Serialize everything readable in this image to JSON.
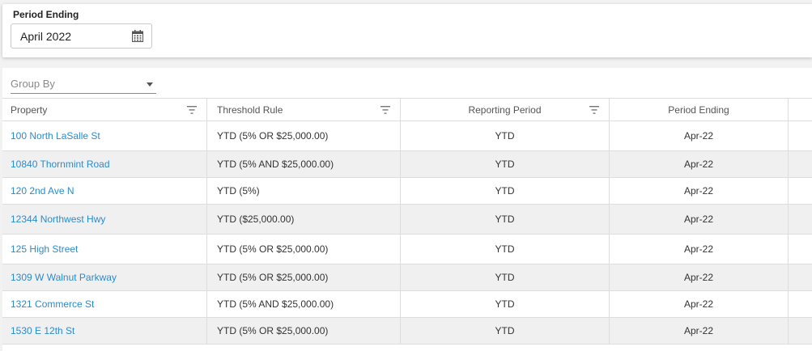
{
  "filters": {
    "period_label": "Period Ending",
    "period_value": "April 2022",
    "period_icon": "calendar-icon"
  },
  "group_by": {
    "placeholder": "Group By"
  },
  "table": {
    "columns": [
      "Property",
      "Threshold Rule",
      "Reporting Period",
      "Period Ending"
    ],
    "rows": [
      {
        "property": "100 North LaSalle St",
        "threshold": "YTD (5% OR $25,000.00)",
        "reporting": "YTD",
        "period": "Apr-22"
      },
      {
        "property": "10840 Thornmint Road",
        "threshold": "YTD (5% AND $25,000.00)",
        "reporting": "YTD",
        "period": "Apr-22"
      },
      {
        "property": "120 2nd Ave N",
        "threshold": "YTD (5%)",
        "reporting": "YTD",
        "period": "Apr-22"
      },
      {
        "property": "12344 Northwest Hwy",
        "threshold": "YTD ($25,000.00)",
        "reporting": "YTD",
        "period": "Apr-22"
      },
      {
        "property": "125 High Street",
        "threshold": "YTD (5% OR $25,000.00)",
        "reporting": "YTD",
        "period": "Apr-22"
      },
      {
        "property": "1309 W Walnut Parkway",
        "threshold": "YTD (5% OR $25,000.00)",
        "reporting": "YTD",
        "period": "Apr-22"
      },
      {
        "property": "1321 Commerce St",
        "threshold": "YTD (5% AND $25,000.00)",
        "reporting": "YTD",
        "period": "Apr-22"
      },
      {
        "property": "1530 E 12th St",
        "threshold": "YTD (5% OR $25,000.00)",
        "reporting": "YTD",
        "period": "Apr-22"
      }
    ]
  },
  "colors": {
    "link": "#2a8bd0",
    "alt_row": "#f0f0f0",
    "border": "#dddddd"
  }
}
